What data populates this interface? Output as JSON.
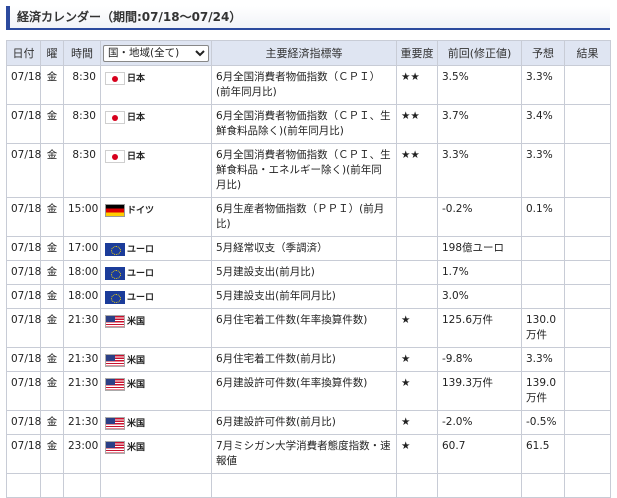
{
  "title": "経済カレンダー（期間:07/18～07/24）",
  "columns": {
    "date": "日付",
    "dow": "曜",
    "time": "時間",
    "country_select": "国・地域(全て)",
    "indicator": "主要経済指標等",
    "importance": "重要度",
    "previous": "前回(修正値)",
    "forecast": "予想",
    "result": "結果"
  },
  "flags": {
    "jp": "japan-flag-icon",
    "de": "germany-flag-icon",
    "eu": "eu-flag-icon",
    "us": "usa-flag-icon"
  },
  "rows": [
    {
      "date": "07/18",
      "dow": "金",
      "time": "8:30",
      "flag": "jp",
      "country": "日本",
      "indicator": "6月全国消費者物価指数（ＣＰＩ）(前年同月比)",
      "importance": "★★",
      "previous": "3.5%",
      "forecast": "3.3%",
      "result": ""
    },
    {
      "date": "07/18",
      "dow": "金",
      "time": "8:30",
      "flag": "jp",
      "country": "日本",
      "indicator": "6月全国消費者物価指数（ＣＰＩ、生鮮食料品除く)(前年同月比)",
      "importance": "★★",
      "previous": "3.7%",
      "forecast": "3.4%",
      "result": ""
    },
    {
      "date": "07/18",
      "dow": "金",
      "time": "8:30",
      "flag": "jp",
      "country": "日本",
      "indicator": "6月全国消費者物価指数（ＣＰＩ、生鮮食料品・エネルギー除く)(前年同月比)",
      "importance": "★★",
      "previous": "3.3%",
      "forecast": "3.3%",
      "result": ""
    },
    {
      "date": "07/18",
      "dow": "金",
      "time": "15:00",
      "flag": "de",
      "country": "ドイツ",
      "indicator": "6月生産者物価指数（ＰＰＩ）(前月比)",
      "importance": "",
      "previous": "-0.2%",
      "forecast": "0.1%",
      "result": ""
    },
    {
      "date": "07/18",
      "dow": "金",
      "time": "17:00",
      "flag": "eu",
      "country": "ユーロ",
      "indicator": "5月経常収支（季調済）",
      "importance": "",
      "previous": "198億ユーロ",
      "forecast": "",
      "result": ""
    },
    {
      "date": "07/18",
      "dow": "金",
      "time": "18:00",
      "flag": "eu",
      "country": "ユーロ",
      "indicator": "5月建設支出(前月比)",
      "importance": "",
      "previous": "1.7%",
      "forecast": "",
      "result": ""
    },
    {
      "date": "07/18",
      "dow": "金",
      "time": "18:00",
      "flag": "eu",
      "country": "ユーロ",
      "indicator": "5月建設支出(前年同月比)",
      "importance": "",
      "previous": "3.0%",
      "forecast": "",
      "result": ""
    },
    {
      "date": "07/18",
      "dow": "金",
      "time": "21:30",
      "flag": "us",
      "country": "米国",
      "indicator": "6月住宅着工件数(年率換算件数)",
      "importance": "★",
      "previous": "125.6万件",
      "forecast": "130.0万件",
      "result": ""
    },
    {
      "date": "07/18",
      "dow": "金",
      "time": "21:30",
      "flag": "us",
      "country": "米国",
      "indicator": "6月住宅着工件数(前月比)",
      "importance": "★",
      "previous": "-9.8%",
      "forecast": "3.3%",
      "result": ""
    },
    {
      "date": "07/18",
      "dow": "金",
      "time": "21:30",
      "flag": "us",
      "country": "米国",
      "indicator": "6月建設許可件数(年率換算件数)",
      "importance": "★",
      "previous": "139.3万件",
      "forecast": "139.0万件",
      "result": ""
    },
    {
      "date": "07/18",
      "dow": "金",
      "time": "21:30",
      "flag": "us",
      "country": "米国",
      "indicator": "6月建設許可件数(前月比)",
      "importance": "★",
      "previous": "-2.0%",
      "forecast": "-0.5%",
      "result": ""
    },
    {
      "date": "07/18",
      "dow": "金",
      "time": "23:00",
      "flag": "us",
      "country": "米国",
      "indicator": "7月ミシガン大学消費者態度指数・速報値",
      "importance": "★",
      "previous": "60.7",
      "forecast": "61.5",
      "result": ""
    }
  ]
}
